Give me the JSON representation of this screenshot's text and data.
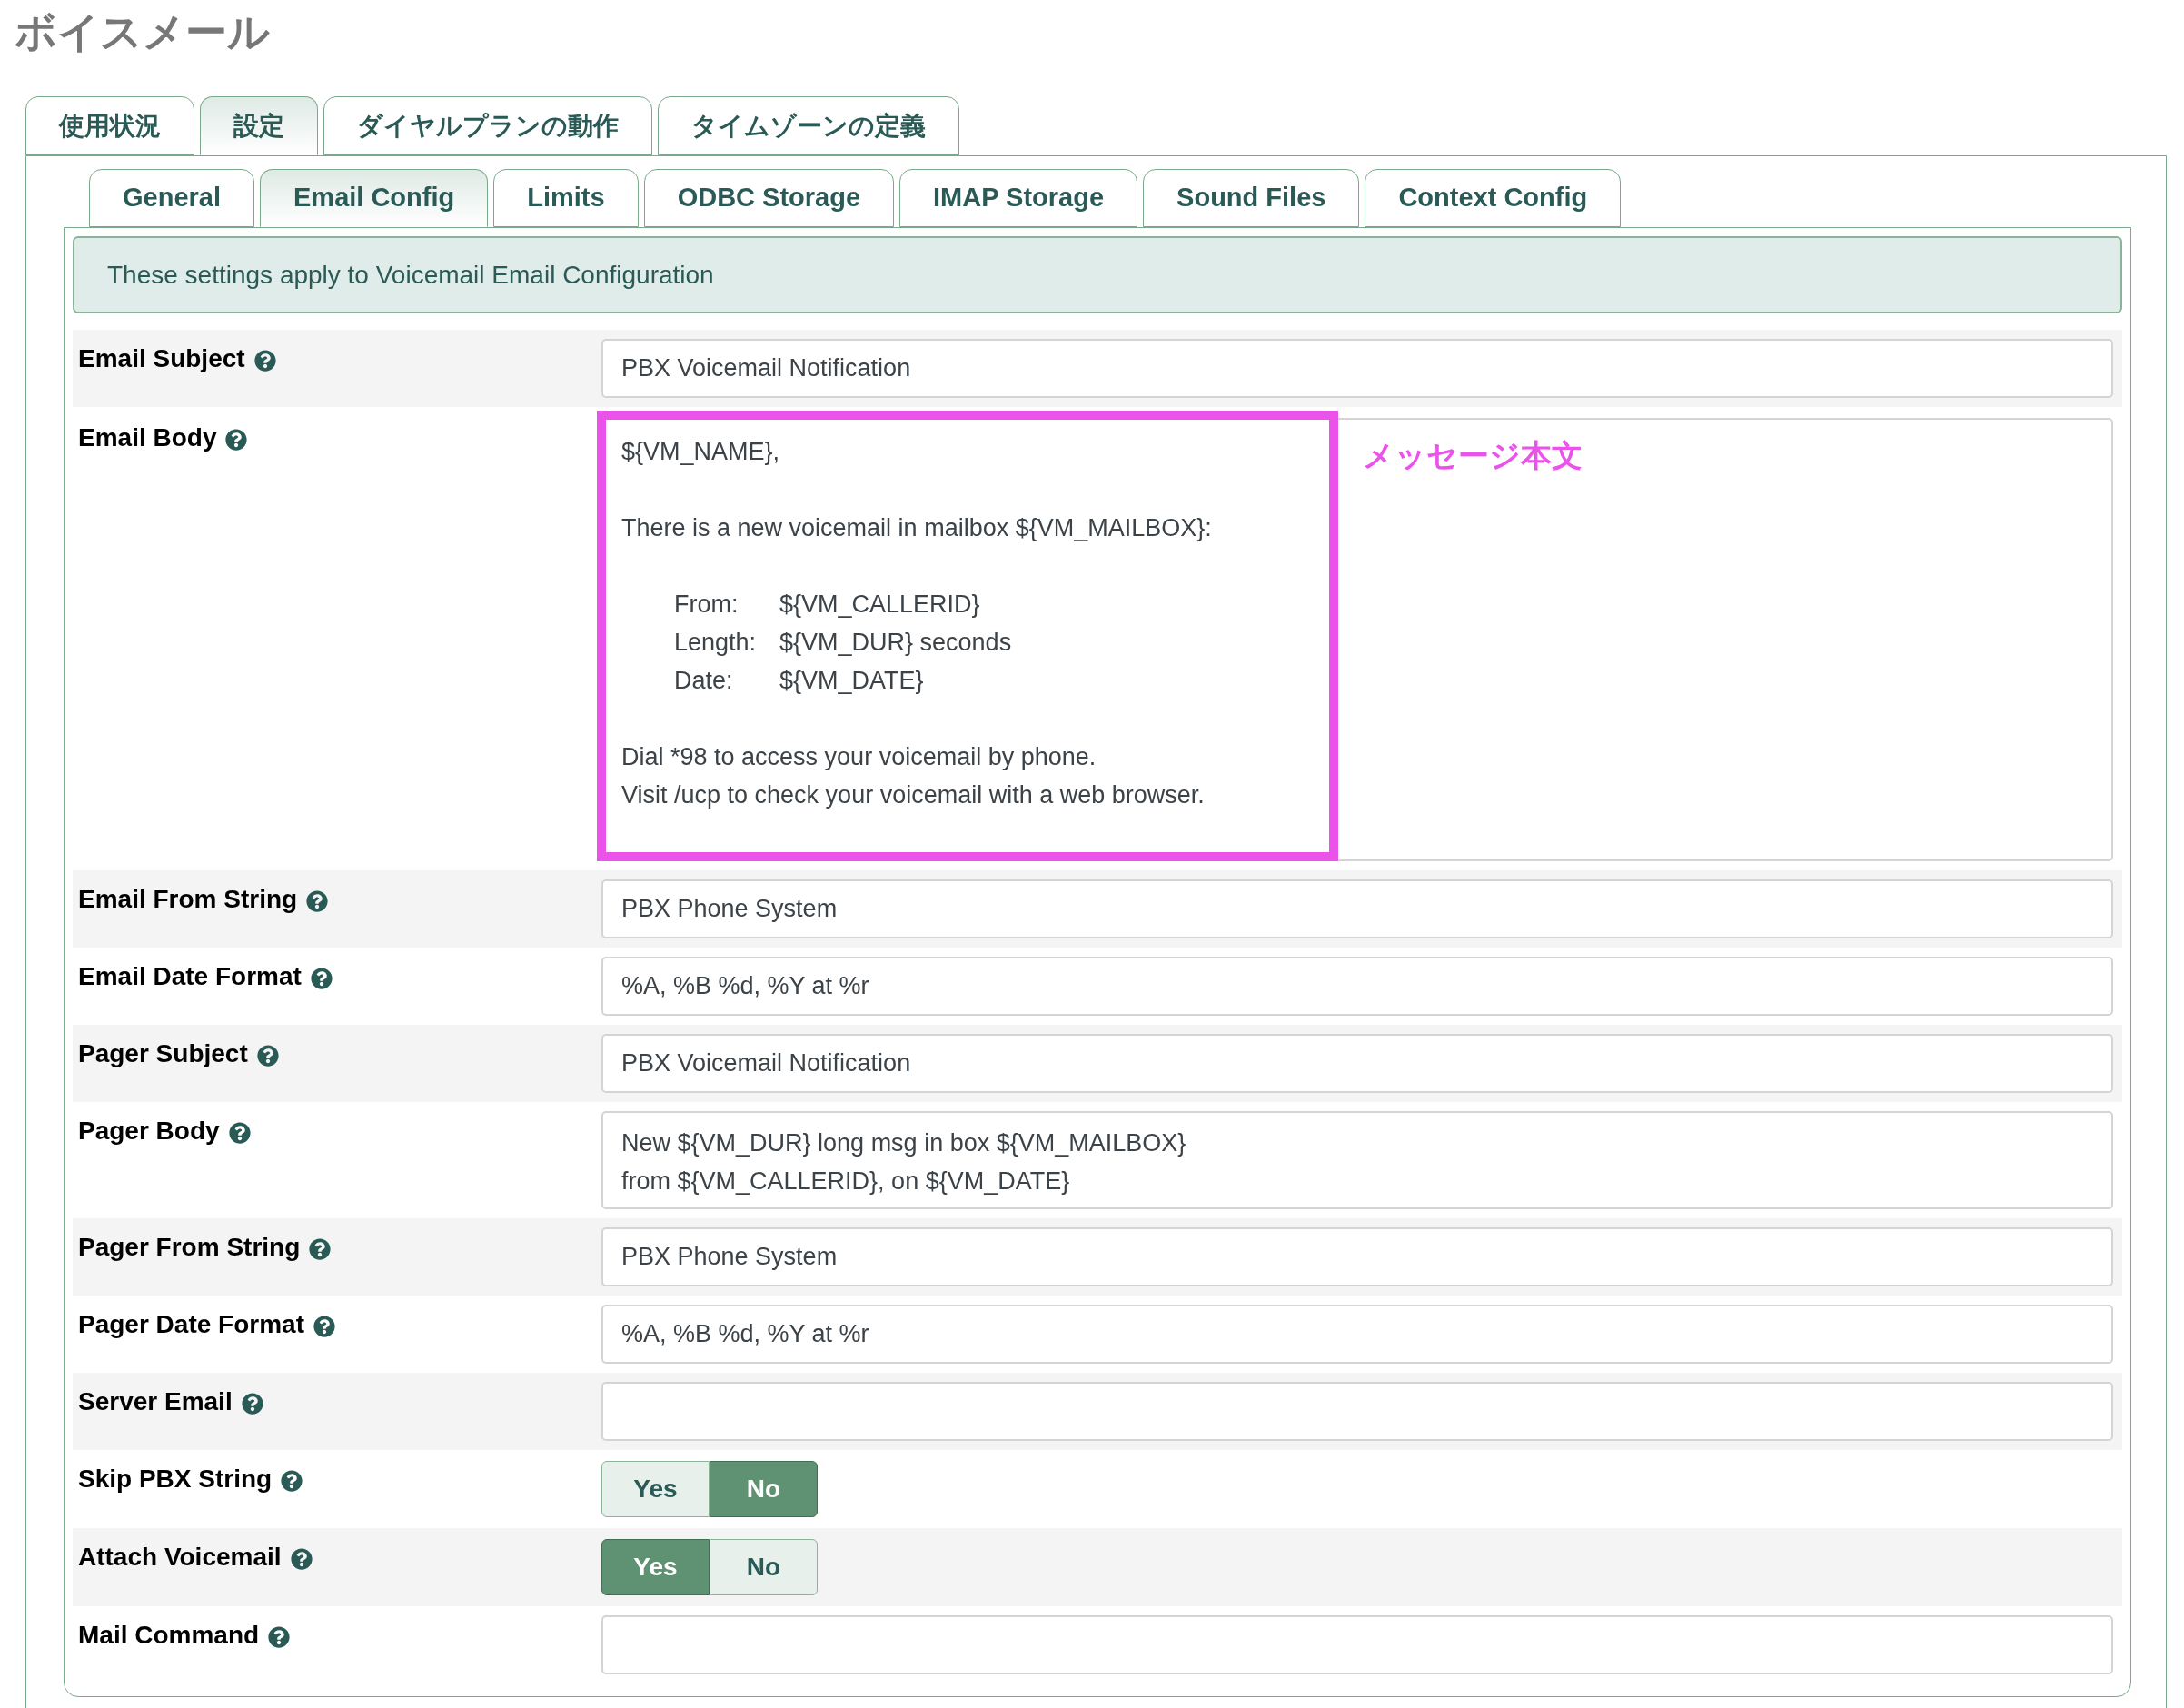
{
  "title": "ボイスメール",
  "tabs": [
    {
      "label": "使用状況",
      "selected": false
    },
    {
      "label": "設定",
      "selected": true
    },
    {
      "label": "ダイヤルプランの動作",
      "selected": false
    },
    {
      "label": "タイムゾーンの定義",
      "selected": false
    }
  ],
  "subtabs": [
    {
      "label": "General",
      "selected": false
    },
    {
      "label": "Email Config",
      "selected": true
    },
    {
      "label": "Limits",
      "selected": false
    },
    {
      "label": "ODBC Storage",
      "selected": false
    },
    {
      "label": "IMAP Storage",
      "selected": false
    },
    {
      "label": "Sound Files",
      "selected": false
    },
    {
      "label": "Context Config",
      "selected": false
    }
  ],
  "info": "These settings apply to Voicemail Email Configuration",
  "fields": [
    {
      "label": "Email Subject",
      "kind": "text",
      "value": "PBX Voicemail Notification"
    },
    {
      "label": "Email Body",
      "kind": "editor",
      "value": "${VM_NAME},\n\nThere is a new voicemail in mailbox ${VM_MAILBOX}:\n\n\tFrom:\t${VM_CALLERID}\n\tLength:\t${VM_DUR} seconds\n\tDate:\t${VM_DATE}\n\nDial *98 to access your voicemail by phone.\nVisit /ucp to check your voicemail with a web browser.",
      "annotation": "メッセージ本文"
    },
    {
      "label": "Email From String",
      "kind": "text",
      "value": "PBX Phone System"
    },
    {
      "label": "Email Date Format",
      "kind": "text",
      "value": "%A, %B %d, %Y at %r"
    },
    {
      "label": "Pager Subject",
      "kind": "text",
      "value": "PBX Voicemail Notification"
    },
    {
      "label": "Pager Body",
      "kind": "textarea",
      "value": "New ${VM_DUR} long msg in box ${VM_MAILBOX}\nfrom ${VM_CALLERID}, on ${VM_DATE}"
    },
    {
      "label": "Pager From String",
      "kind": "text",
      "value": "PBX Phone System"
    },
    {
      "label": "Pager Date Format",
      "kind": "text",
      "value": "%A, %B %d, %Y at %r"
    },
    {
      "label": "Server Email",
      "kind": "text"
    },
    {
      "label": "Skip PBX String",
      "kind": "toggle",
      "options": [
        {
          "label": "Yes",
          "selected": false
        },
        {
          "label": "No",
          "selected": true
        }
      ]
    },
    {
      "label": "Attach Voicemail",
      "kind": "toggle",
      "options": [
        {
          "label": "Yes",
          "selected": true
        },
        {
          "label": "No",
          "selected": false
        }
      ]
    },
    {
      "label": "Mail Command",
      "kind": "text"
    }
  ]
}
